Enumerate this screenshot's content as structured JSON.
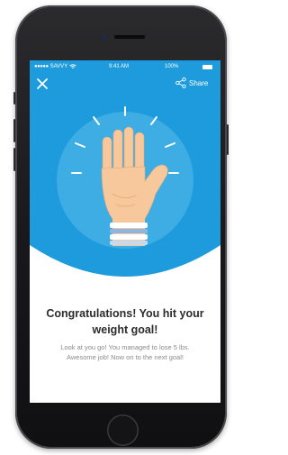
{
  "status_bar": {
    "carrier": "SAVVY",
    "time": "9:41 AM",
    "battery": "100%"
  },
  "header": {
    "close_icon": "close-icon",
    "share_label": "Share",
    "share_icon": "share-icon"
  },
  "illustration": {
    "subject": "raised-hand-icon"
  },
  "content": {
    "title": "Congratulations! You hit your weight goal!",
    "body": "Look at you go! You managed to lose 5 lbs. Awesome job! Now on to the next goal!"
  },
  "colors": {
    "brand_blue": "#1e9bdc",
    "circle_blue": "#3dade4",
    "skin": "#f7c89b",
    "title_text": "#2b2b2b",
    "body_text": "#8a8a8a"
  }
}
